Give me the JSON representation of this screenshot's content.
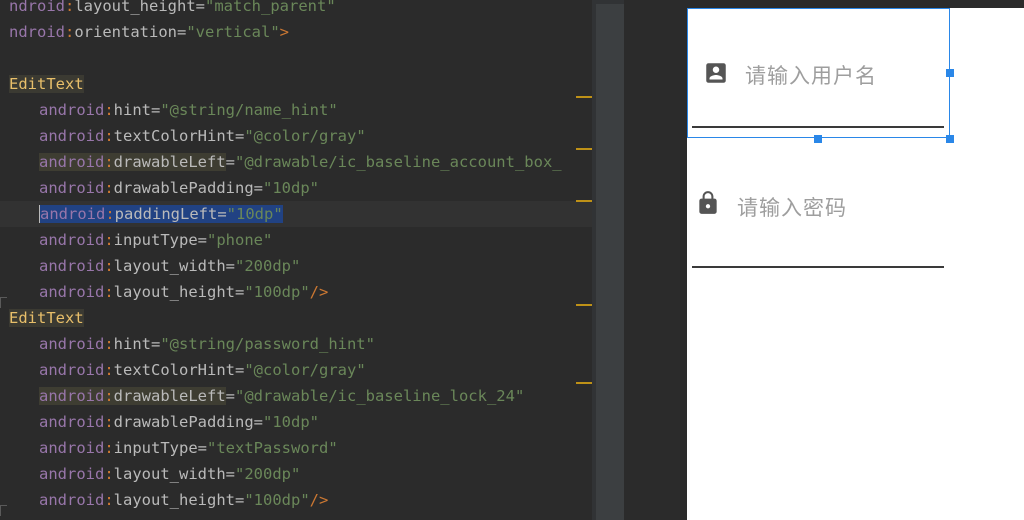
{
  "editor": {
    "lines": [
      {
        "ns": "ndroid",
        "attr": "layout_height",
        "val": "\"match_parent\"",
        "indent": "",
        "end": ""
      },
      {
        "ns": "ndroid",
        "attr": "orientation",
        "val": "\"vertical\"",
        "indent": "",
        "end": ">"
      },
      {
        "blank": true
      },
      {
        "tag": "EditText"
      },
      {
        "ns": "android",
        "attr": "hint",
        "val": "\"@string/name_hint\"",
        "indent": "   ",
        "end": ""
      },
      {
        "ns": "android",
        "attr": "textColorHint",
        "val": "\"@color/gray\"",
        "indent": "   ",
        "end": ""
      },
      {
        "ns": "android",
        "attr": "drawableLeft",
        "val": "\"@drawable/ic_baseline_account_box_",
        "indent": "   ",
        "end": "",
        "highlight": true
      },
      {
        "ns": "android",
        "attr": "drawablePadding",
        "val": "\"10dp\"",
        "indent": "   ",
        "end": ""
      },
      {
        "ns": "android",
        "attr": "paddingLeft",
        "val": "\"10dp\"",
        "indent": "   ",
        "end": "",
        "selected": true
      },
      {
        "ns": "android",
        "attr": "inputType",
        "val": "\"phone\"",
        "indent": "   ",
        "end": ""
      },
      {
        "ns": "android",
        "attr": "layout_width",
        "val": "\"200dp\"",
        "indent": "   ",
        "end": ""
      },
      {
        "ns": "android",
        "attr": "layout_height",
        "val": "\"100dp\"",
        "indent": "   ",
        "end": "/>"
      },
      {
        "tag": "EditText"
      },
      {
        "ns": "android",
        "attr": "hint",
        "val": "\"@string/password_hint\"",
        "indent": "   ",
        "end": ""
      },
      {
        "ns": "android",
        "attr": "textColorHint",
        "val": "\"@color/gray\"",
        "indent": "   ",
        "end": ""
      },
      {
        "ns": "android",
        "attr": "drawableLeft",
        "val": "\"@drawable/ic_baseline_lock_24\"",
        "indent": "   ",
        "end": "",
        "highlight": true
      },
      {
        "ns": "android",
        "attr": "drawablePadding",
        "val": "\"10dp\"",
        "indent": "   ",
        "end": ""
      },
      {
        "ns": "android",
        "attr": "inputType",
        "val": "\"textPassword\"",
        "indent": "   ",
        "end": ""
      },
      {
        "ns": "android",
        "attr": "layout_width",
        "val": "\"200dp\"",
        "indent": "   ",
        "end": ""
      },
      {
        "ns": "android",
        "attr": "layout_height",
        "val": "\"100dp\"",
        "indent": "   ",
        "end": "/>"
      }
    ]
  },
  "preview": {
    "username_field": {
      "hint": "请输入用户名",
      "icon": "account-box-icon"
    },
    "password_field": {
      "hint": "请输入密码",
      "icon": "lock-icon"
    }
  },
  "colors": {
    "selection_blue": "#2a87e8",
    "hint_gray": "#9e9e9e",
    "warning_stripe": "#be9117"
  }
}
